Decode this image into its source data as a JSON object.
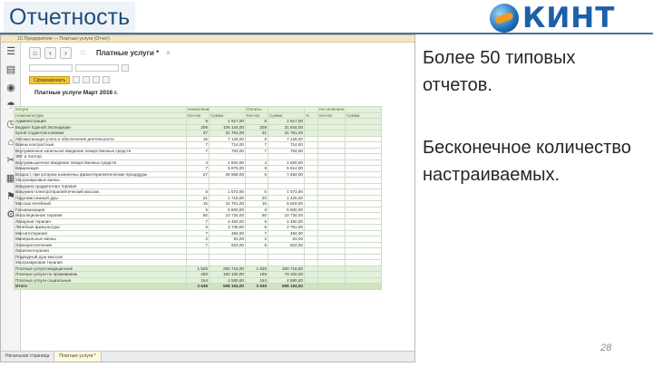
{
  "slide": {
    "title": "Отчетность",
    "logo_text": "КИНТ",
    "bullets": [
      "Более 50 типовых отчетов.",
      "Бесконечное количество настраиваемых."
    ],
    "page_number": "28"
  },
  "screenshot": {
    "window_title": "1С:Предприятие — Платные услуги (Отчет)",
    "document_title": "Платные услуги *",
    "report_title": "Платные услуги Март 2016 г.",
    "form_button": "Сформировать",
    "taskbar": [
      "Начальная страница",
      "Платные услуги *"
    ],
    "sidebar_icons": [
      "menu-icon",
      "chart-icon",
      "coin-icon",
      "umbrella-icon",
      "clock-icon",
      "basket-icon",
      "tools-icon",
      "grid-icon",
      "flag-icon",
      "gear-icon"
    ],
    "headers": [
      [
        "Услуга",
        "Начисления",
        "",
        "Оплаты",
        "",
        "",
        "Не оплачено",
        ""
      ],
      [
        "Номенклатура",
        "Кол-во",
        "Сумма",
        "Кол-во",
        "Сумма",
        "%",
        "Кол-во",
        "Сумма"
      ]
    ],
    "rows": [
      {
        "t": "grp",
        "c": [
          "Администрация",
          "5",
          "1 517,00",
          "5",
          "1 517,00",
          "",
          ""
        ]
      },
      {
        "t": "grp",
        "c": [
          "Бюджет Единой Экспедиции",
          "206",
          "106 144,00",
          "208",
          "31 844,00",
          "",
          ""
        ]
      },
      {
        "t": "grp",
        "c": [
          "Кухня студентов клиники",
          "27",
          "31 751,00",
          "21",
          "31 751,00",
          "",
          ""
        ]
      },
      {
        "t": "",
        "c": [
          "Автоматизация учета и обеспечения деятельности",
          "16",
          "7 126,00",
          "6",
          "7 126,00",
          "",
          ""
        ]
      },
      {
        "t": "",
        "c": [
          "Ванны контрастные",
          "7",
          "714,00",
          "7",
          "714,00",
          "",
          ""
        ]
      },
      {
        "t": "",
        "c": [
          "Внутривенное капельное введение лекарственных средств",
          "7",
          "704,00",
          "7",
          "704,00",
          "",
          ""
        ]
      },
      {
        "t": "",
        "c": [
          "ЭКГ и Холтер",
          "",
          "",
          "",
          "",
          "",
          ""
        ]
      },
      {
        "t": "",
        "c": [
          "Внутримышечное введение лекарственных средств",
          "4",
          "1 820,00",
          "4",
          "1 820,00",
          "",
          ""
        ]
      },
      {
        "t": "",
        "c": [
          "Вакцинация",
          "7",
          "5 875,00",
          "6",
          "5 614,00",
          "",
          ""
        ]
      },
      {
        "t": "",
        "c": [
          "Возраст, при котором назначены физиотерапевтические процедуры",
          "27",
          "28 568,00",
          "6",
          "7 484,00",
          "",
          ""
        ]
      },
      {
        "t": "",
        "c": [
          "Ультразвуковые ванны",
          "",
          "",
          "",
          "",
          "",
          ""
        ]
      },
      {
        "t": "",
        "c": [
          "Вакуумно-градиентная терапия",
          "",
          "",
          "",
          "",
          "",
          ""
        ]
      },
      {
        "t": "",
        "c": [
          "Вакуумно-электротерапевтический массаж",
          "5",
          "1 573,00",
          "5",
          "1 573,00",
          "",
          ""
        ]
      },
      {
        "t": "",
        "c": [
          "Гидромассажный душ",
          "21",
          "1 716,00",
          "20",
          "1 425,00",
          "",
          ""
        ]
      },
      {
        "t": "",
        "c": [
          "Массаж лечебный",
          "15",
          "15 701,00",
          "15",
          "6 819,00",
          "",
          ""
        ]
      },
      {
        "t": "",
        "c": [
          "Гальванизация",
          "6",
          "5 600,00",
          "6",
          "5 600,00",
          "",
          ""
        ]
      },
      {
        "t": "",
        "c": [
          "Ингаляционная терапия",
          "60",
          "10 734,00",
          "60",
          "10 734,00",
          "",
          ""
        ]
      },
      {
        "t": "",
        "c": [
          "Лазерная терапия",
          "7",
          "4 450,00",
          "5",
          "4 450,00",
          "",
          ""
        ]
      },
      {
        "t": "",
        "c": [
          "Лечебная физкультура",
          "8",
          "3 730,00",
          "6",
          "2 761,00",
          "",
          ""
        ]
      },
      {
        "t": "",
        "c": [
          "Магнитотерапия",
          "7",
          "484,00",
          "7",
          "484,00",
          "",
          ""
        ]
      },
      {
        "t": "",
        "c": [
          "Минеральные ванны",
          "2",
          "53,00",
          "2",
          "53,00",
          "",
          ""
        ]
      },
      {
        "t": "",
        "c": [
          "Озокеритолечение",
          "7",
          "924,00",
          "6",
          "924,00",
          "",
          ""
        ]
      },
      {
        "t": "",
        "c": [
          "Оксигенотерапия",
          "",
          "",
          "",
          "",
          "",
          ""
        ]
      },
      {
        "t": "",
        "c": [
          "Подводный душ-массаж",
          "",
          "",
          "",
          "",
          "",
          ""
        ]
      },
      {
        "t": "",
        "c": [
          "Ультразвуковая терапия",
          "",
          "",
          "",
          "",
          "",
          ""
        ]
      },
      {
        "t": "grp",
        "c": [
          "Платные услуги медицинские",
          "1 626",
          "260 716,00",
          "1 626",
          "260 716,00",
          "",
          ""
        ]
      },
      {
        "t": "grp",
        "c": [
          "Платные услуги по проживанию",
          "400",
          "150 100,00",
          "195",
          "70 100,00",
          "",
          ""
        ]
      },
      {
        "t": "grp",
        "c": [
          "Платные услуги социальные",
          "154",
          "4 580,00",
          "154",
          "4 580,00",
          "",
          ""
        ]
      },
      {
        "t": "tot",
        "c": [
          "Итого",
          "3 636",
          "598 194,00",
          "3 636",
          "598 194,00",
          "",
          ""
        ]
      }
    ]
  }
}
